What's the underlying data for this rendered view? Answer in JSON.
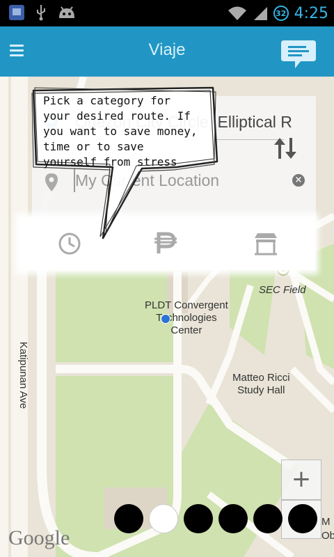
{
  "status_bar": {
    "time": "4:25",
    "battery_level": "32",
    "icons": [
      "notification-app-icon",
      "usb-icon",
      "android-debug-icon",
      "wifi-icon",
      "signal-icon",
      "battery-icon"
    ]
  },
  "action_bar": {
    "title": "Viaje",
    "menu_icon": "hamburger-menu-icon",
    "right_icon": "chat-bubble-icon"
  },
  "route": {
    "origin_value": "Quezon City Circle, Elliptical R",
    "destination_placeholder": "My Current Location"
  },
  "categories": [
    {
      "name": "time",
      "icon": "clock-icon"
    },
    {
      "name": "money",
      "icon": "peso-icon"
    },
    {
      "name": "comfort",
      "icon": "store-icon"
    }
  ],
  "tutorial": {
    "text": "Pick a category for your desired route. If you want to save money, time or to save yourself from stress"
  },
  "map": {
    "labels": {
      "sec_field": "SEC Field",
      "pldt_l1": "PLDT Convergent",
      "pldt_l2": "Technologies",
      "pldt_l3": "Center",
      "matteo_l1": "Matteo Ricci",
      "matteo_l2": "Study Hall",
      "katipunan": "Katipunan Ave",
      "edge_l1": "M",
      "edge_l2": "Ob"
    },
    "logo": "Google",
    "zoom_in": "+"
  },
  "pager": {
    "count": 6,
    "active_index": 1
  },
  "colors": {
    "action_bar": "#2196c4",
    "status_accent": "#33b5e5",
    "map_bg": "#e9e4d7",
    "green_area": "#cfe2b0"
  }
}
